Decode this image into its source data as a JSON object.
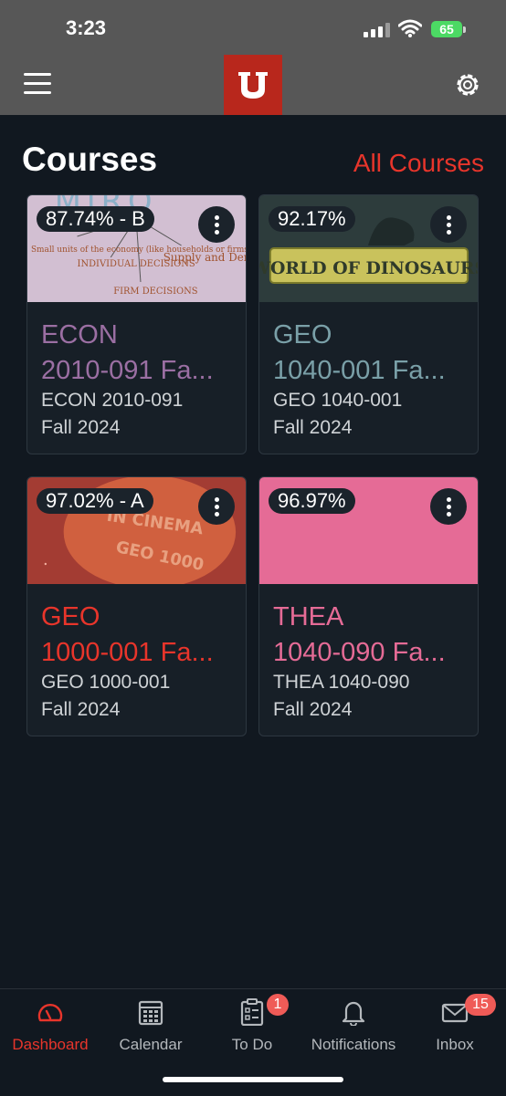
{
  "status_bar": {
    "time": "3:23",
    "battery": "65"
  },
  "header": {
    "title": "Courses",
    "all_courses": "All Courses"
  },
  "courses": [
    {
      "grade": "87.74% - B",
      "name": "ECON\n2010-091 Fa...",
      "code": "ECON 2010-091",
      "term": "Fall 2024",
      "color": "#9b6fa3",
      "image_text": {
        "top": "MIRO",
        "a": "Small units of the economy (like households or firms)",
        "b": "INDIVIDUAL DECISIONS",
        "c": "FIRM DECISIONS",
        "d": "Supply and Demand"
      }
    },
    {
      "grade": "92.17%",
      "name": "GEO\n1040-001 Fa...",
      "code": "GEO 1040-001",
      "term": "Fall 2024",
      "color": "#7aa0a8",
      "image_text": {
        "logo": "WORLD OF DINOSAURS"
      }
    },
    {
      "grade": "97.02% - A",
      "name": "GEO\n1000-001 Fa...",
      "code": "GEO 1000-001",
      "term": "Fall 2024",
      "color": "#e8352b",
      "image_text": {
        "a": "IN CINEMA",
        "b": "GEO 1000"
      }
    },
    {
      "grade": "96.97%",
      "name": "THEA\n1040-090 Fa...",
      "code": "THEA 1040-090",
      "term": "Fall 2024",
      "color": "#e56b96"
    }
  ],
  "tabs": [
    {
      "label": "Dashboard",
      "icon": "dashboard-icon",
      "active": true
    },
    {
      "label": "Calendar",
      "icon": "calendar-icon"
    },
    {
      "label": "To Do",
      "icon": "todo-icon",
      "badge": "1"
    },
    {
      "label": "Notifications",
      "icon": "bell-icon"
    },
    {
      "label": "Inbox",
      "icon": "inbox-icon",
      "badge": "15"
    }
  ],
  "colors": {
    "accent": "#e8352b",
    "background": "#111820",
    "nav": "#575757",
    "logo": "#b8271c"
  }
}
